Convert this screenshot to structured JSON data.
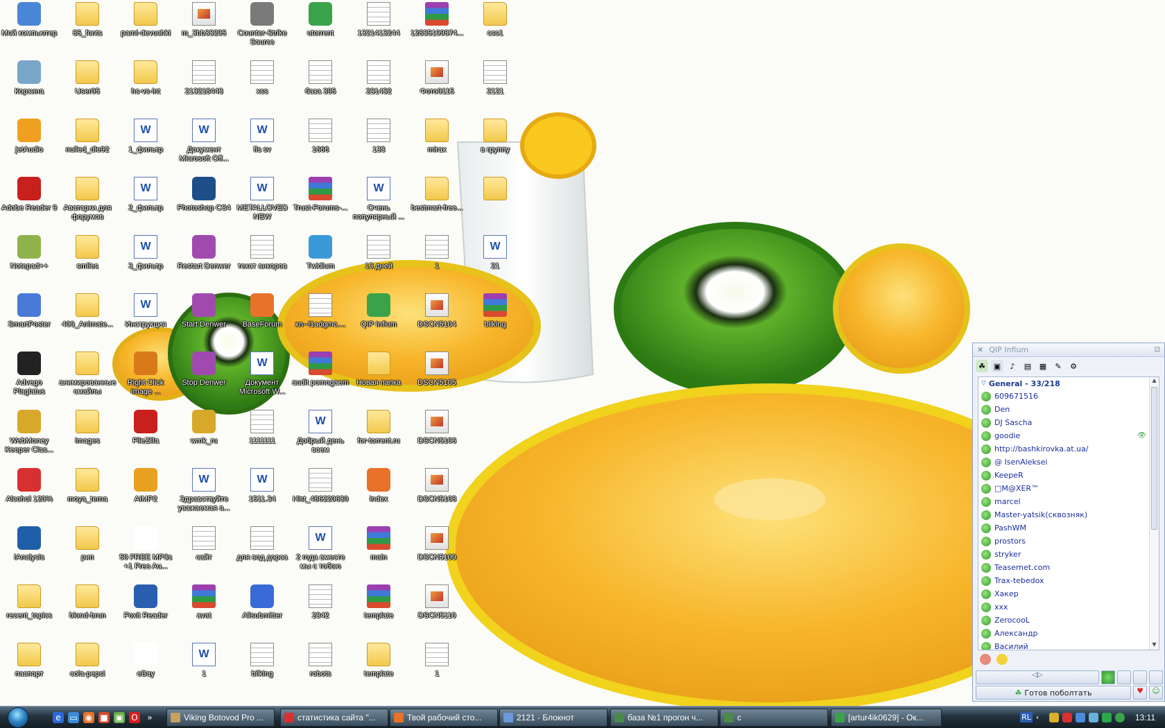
{
  "desktop": {
    "icons": [
      {
        "label": "Мой компьютер",
        "type": "app",
        "color": "#4a86d8"
      },
      {
        "label": "85_fonts",
        "type": "folder"
      },
      {
        "label": "parni-devuchki",
        "type": "folder"
      },
      {
        "label": "m_3bb33295",
        "type": "img"
      },
      {
        "label": "Counter-Strike Source",
        "type": "app",
        "color": "#7a7a7a"
      },
      {
        "label": "utorrent",
        "type": "app",
        "color": "#3aa34a"
      },
      {
        "label": "1321413244",
        "type": "doc"
      },
      {
        "label": "12835199874...",
        "type": "rar"
      },
      {
        "label": "css1",
        "type": "folder"
      },
      {
        "label": "Корзина",
        "type": "app",
        "color": "#7aa6c8"
      },
      {
        "label": "User05",
        "type": "folder"
      },
      {
        "label": "hs-vs-int",
        "type": "folder"
      },
      {
        "label": "213218443",
        "type": "doc"
      },
      {
        "label": "xss",
        "type": "doc"
      },
      {
        "label": "база 395",
        "type": "doc"
      },
      {
        "label": "231432",
        "type": "doc"
      },
      {
        "label": "Фото0115",
        "type": "img"
      },
      {
        "label": "2121",
        "type": "doc"
      },
      {
        "label": "jetAudio",
        "type": "app",
        "color": "#f0a020"
      },
      {
        "label": "nulled_dle92",
        "type": "folder"
      },
      {
        "label": "1_фильтр",
        "type": "word"
      },
      {
        "label": "Документ Microsoft Off...",
        "type": "word"
      },
      {
        "label": "fls sv",
        "type": "word"
      },
      {
        "label": "1666",
        "type": "doc"
      },
      {
        "label": "133",
        "type": "doc"
      },
      {
        "label": "mirax",
        "type": "folder"
      },
      {
        "label": "в группу",
        "type": "folder"
      },
      {
        "label": "Adobe Reader 9",
        "type": "app",
        "color": "#c8201c"
      },
      {
        "label": "Аватарки для форумов",
        "type": "folder"
      },
      {
        "label": "2_фильтр",
        "type": "word"
      },
      {
        "label": "Photoshop CS4",
        "type": "app",
        "color": "#1d4e8a"
      },
      {
        "label": "METALLOVED NEW",
        "type": "word"
      },
      {
        "label": "Trust-Forums-...",
        "type": "rar"
      },
      {
        "label": "Очень популярный ...",
        "type": "word"
      },
      {
        "label": "bestmart-free...",
        "type": "folder"
      },
      {
        "label": "",
        "type": "folder"
      },
      {
        "label": "Notepad++",
        "type": "app",
        "color": "#8fb34a"
      },
      {
        "label": "smiles",
        "type": "folder"
      },
      {
        "label": "3_фильтр",
        "type": "word"
      },
      {
        "label": "Restart Denwer",
        "type": "app",
        "color": "#a04ab0"
      },
      {
        "label": "текст анкоров",
        "type": "doc"
      },
      {
        "label": "Twidium",
        "type": "app",
        "color": "#3a9ad8"
      },
      {
        "label": "13 дней",
        "type": "doc"
      },
      {
        "label": "1",
        "type": "doc"
      },
      {
        "label": "21",
        "type": "word"
      },
      {
        "label": "SmartPoster",
        "type": "app",
        "color": "#4a7ad8"
      },
      {
        "label": "400_Animate...",
        "type": "folder"
      },
      {
        "label": "Инструкция",
        "type": "word"
      },
      {
        "label": "Start Denwer",
        "type": "app",
        "color": "#a04ab0"
      },
      {
        "label": "BaseForum",
        "type": "app",
        "color": "#e8722a"
      },
      {
        "label": "xn--l1adgmc....",
        "type": "doc"
      },
      {
        "label": "QIP Infium",
        "type": "app",
        "color": "#3aa34a"
      },
      {
        "label": "DSCN5104",
        "type": "img"
      },
      {
        "label": "bilking",
        "type": "rar"
      },
      {
        "label": "Advego Plagiatus",
        "type": "app",
        "color": "#222222"
      },
      {
        "label": "анимированные смайлы",
        "type": "folder"
      },
      {
        "label": "Right Click Image ...",
        "type": "app",
        "color": "#d87a1a"
      },
      {
        "label": "Stop Denwer",
        "type": "app",
        "color": "#a04ab0"
      },
      {
        "label": "Документ Microsoft W...",
        "type": "word"
      },
      {
        "label": "audit pomogaem",
        "type": "rar"
      },
      {
        "label": "Новая папка",
        "type": "folder"
      },
      {
        "label": "DSCN5105",
        "type": "img"
      },
      {
        "label": "WebMoney Keeper Clas...",
        "type": "app",
        "color": "#d8a82a"
      },
      {
        "label": "images",
        "type": "folder"
      },
      {
        "label": "FileZilla",
        "type": "app",
        "color": "#c8201c"
      },
      {
        "label": "wmk_ru",
        "type": "app",
        "color": "#d8a82a"
      },
      {
        "label": "1111111",
        "type": "doc"
      },
      {
        "label": "Добрый день всем",
        "type": "word"
      },
      {
        "label": "for-torrent.ru",
        "type": "folder"
      },
      {
        "label": "DSCN5106",
        "type": "img"
      },
      {
        "label": "Alcohol 120%",
        "type": "app",
        "color": "#d83030"
      },
      {
        "label": "moya_tema",
        "type": "folder"
      },
      {
        "label": "AIMP2",
        "type": "app",
        "color": "#e8a020"
      },
      {
        "label": "Здравствуйте уважаемая а...",
        "type": "word"
      },
      {
        "label": "1511.34",
        "type": "word"
      },
      {
        "label": "Hist_486220630",
        "type": "doc"
      },
      {
        "label": "index",
        "type": "app",
        "color": "#e8722a"
      },
      {
        "label": "DSCN5108",
        "type": "img"
      },
      {
        "label": "iAnalysis",
        "type": "app",
        "color": "#1f5fa8"
      },
      {
        "label": "рип",
        "type": "folder"
      },
      {
        "label": "50 FREE MP3s +1 Free Au...",
        "type": "app",
        "color": "#ffffff"
      },
      {
        "label": "сайт",
        "type": "doc"
      },
      {
        "label": "для вод дорса",
        "type": "doc"
      },
      {
        "label": "2 годa вместе мы с тобою",
        "type": "word"
      },
      {
        "label": "main",
        "type": "rar"
      },
      {
        "label": "DSCN5109",
        "type": "img"
      },
      {
        "label": "recent_topics",
        "type": "folder"
      },
      {
        "label": "blond-brun",
        "type": "folder"
      },
      {
        "label": "Foxit Reader",
        "type": "app",
        "color": "#2a5fb0"
      },
      {
        "label": "avat",
        "type": "rar"
      },
      {
        "label": "Allsubmitter",
        "type": "app",
        "color": "#3a6ad8"
      },
      {
        "label": "2342",
        "type": "doc"
      },
      {
        "label": "template",
        "type": "rar"
      },
      {
        "label": "DSCN5110",
        "type": "img"
      },
      {
        "label": "паспорт",
        "type": "folder"
      },
      {
        "label": "cola-pepsi",
        "type": "folder"
      },
      {
        "label": "eBay",
        "type": "app",
        "color": "#ffffff"
      },
      {
        "label": "1",
        "type": "word"
      },
      {
        "label": "bilking",
        "type": "doc"
      },
      {
        "label": "robots",
        "type": "doc"
      },
      {
        "label": "template",
        "type": "folder"
      },
      {
        "label": "1",
        "type": "doc"
      }
    ]
  },
  "qip": {
    "title": "QIP Infium",
    "group": {
      "name": "General - 33/218"
    },
    "contacts": [
      "609671516",
      "Den",
      "DJ Sascha",
      "goodie",
      "http://bashkirovka.at.ua/",
      "@ IsenAleksei",
      "KeepeR",
      "□M@XER™",
      "marcel",
      "Master-yatsik(сквозняк)",
      "PashWM",
      "prostors",
      "stryker",
      "Teasernet.com",
      "Trax-tebedox",
      "Хакер",
      "xxx",
      "ZerocooL",
      "Александр",
      "Василий"
    ],
    "status_label": "Готов поболтать",
    "status_color": "#3aa34a"
  },
  "taskbar": {
    "buttons": [
      {
        "label": "Viking Botovod Pro ...",
        "color": "#c8a060"
      },
      {
        "label": "статистика сайта \"...",
        "color": "#d83030"
      },
      {
        "label": "Твой рабочий сто...",
        "color": "#e8722a"
      },
      {
        "label": "2121 - Блокнот",
        "color": "#6a9ad8"
      },
      {
        "label": "база №1 прогон ч...",
        "color": "#4a8a4a"
      },
      {
        "label": "с",
        "color": "#4a8a4a"
      },
      {
        "label": "[artur4ik0629] - Ок...",
        "color": "#3aa34a"
      }
    ],
    "tray": {
      "lang": "RL",
      "time": "13:11"
    }
  }
}
